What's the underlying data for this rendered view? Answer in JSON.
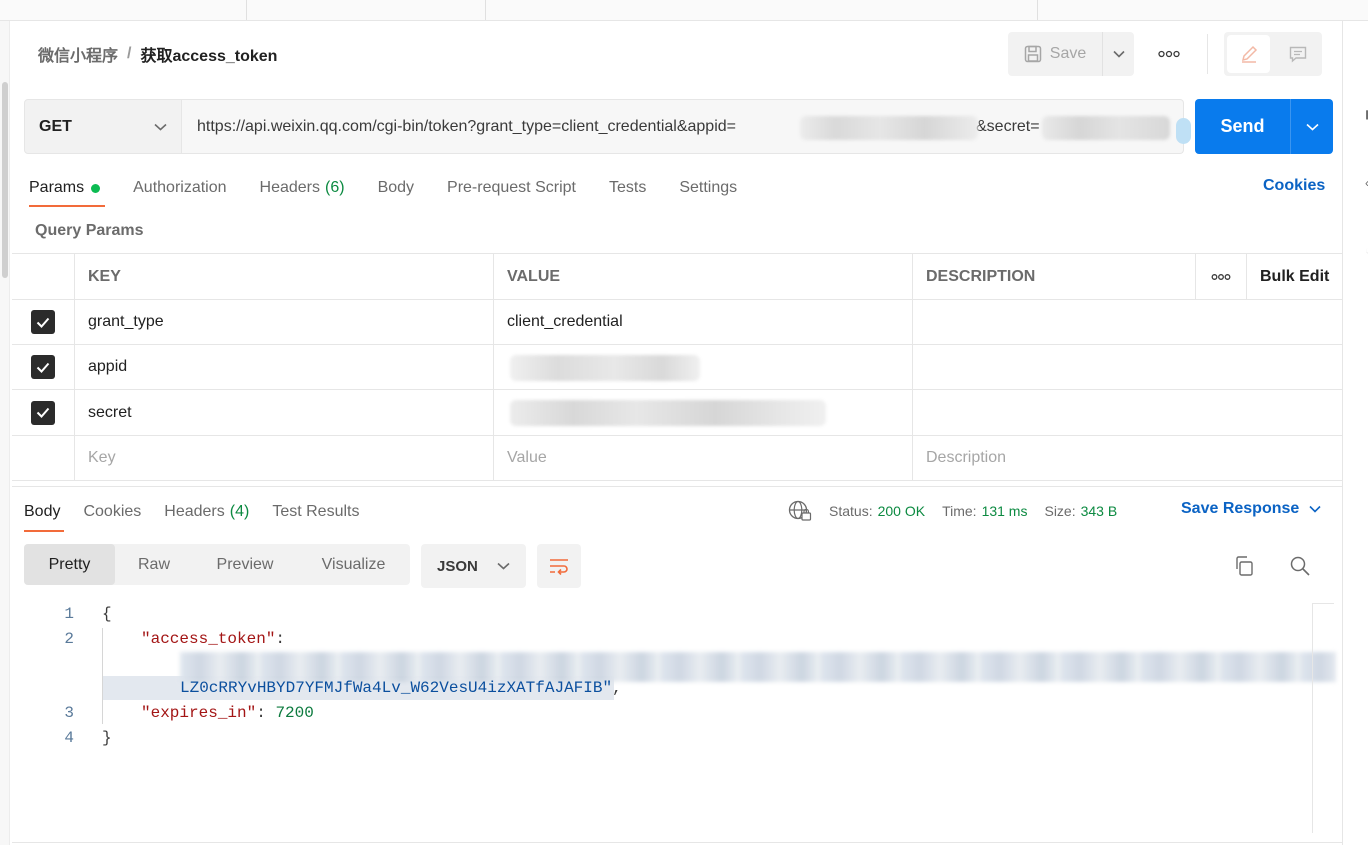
{
  "breadcrumb": {
    "parent": "微信小程序",
    "separator": "/",
    "current": "获取access_token"
  },
  "header": {
    "save_label": "Save"
  },
  "request": {
    "method": "GET",
    "url": "https://api.weixin.qq.com/cgi-bin/token?grant_type=client_credential&appid=",
    "url_secret_part": "&secret=",
    "send_label": "Send"
  },
  "request_tabs": {
    "params": "Params",
    "authorization": "Authorization",
    "headers": "Headers",
    "headers_count": "(6)",
    "body": "Body",
    "prerequest": "Pre-request Script",
    "tests": "Tests",
    "settings": "Settings",
    "cookies": "Cookies"
  },
  "query_params": {
    "title": "Query Params",
    "columns": {
      "key": "KEY",
      "value": "VALUE",
      "description": "DESCRIPTION",
      "bulk_edit": "Bulk Edit"
    },
    "rows": [
      {
        "key": "grant_type",
        "value": "client_credential",
        "checked": true
      },
      {
        "key": "appid",
        "value": "",
        "checked": true
      },
      {
        "key": "secret",
        "value": "",
        "checked": true
      }
    ],
    "placeholders": {
      "key": "Key",
      "value": "Value",
      "description": "Description"
    }
  },
  "response_tabs": {
    "body": "Body",
    "cookies": "Cookies",
    "headers": "Headers",
    "headers_count": "(4)",
    "test_results": "Test Results"
  },
  "response_status": {
    "status_label": "Status:",
    "status_value": "200 OK",
    "time_label": "Time:",
    "time_value": "131 ms",
    "size_label": "Size:",
    "size_value": "343 B",
    "save_response": "Save Response"
  },
  "view_modes": {
    "pretty": "Pretty",
    "raw": "Raw",
    "preview": "Preview",
    "visualize": "Visualize",
    "format": "JSON"
  },
  "code": {
    "line_numbers": [
      "1",
      "2",
      "3",
      "4"
    ],
    "open_brace": "{",
    "token_key": "\"access_token\"",
    "colon": ":",
    "token_tail": "LZ0cRRYvHBYD7YFMJfWa4Lv_W62VesU4izXATfAJAFIB\"",
    "comma": ",",
    "expires_key": "\"expires_in\"",
    "expires_value": "7200",
    "close_brace": "}"
  },
  "colors": {
    "accent_blue": "#097bed",
    "tab_underline": "#f26b3a",
    "status_green": "#0c8a41",
    "link_blue": "#0b63c4"
  }
}
